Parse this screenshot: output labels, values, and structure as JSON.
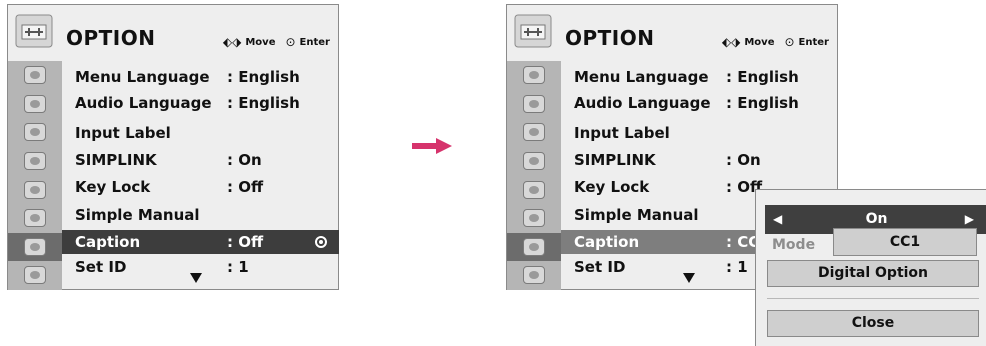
{
  "left_panel": {
    "title": "OPTION",
    "hint_move": "Move",
    "hint_enter": "Enter",
    "rows": [
      {
        "label": "Menu Language",
        "value": ": English"
      },
      {
        "label": "Audio Language",
        "value": ": English"
      },
      {
        "label": "Input Label",
        "value": ""
      },
      {
        "label": "SIMPLINK",
        "value": ": On"
      },
      {
        "label": "Key Lock",
        "value": ": Off"
      },
      {
        "label": "Simple Manual",
        "value": ""
      },
      {
        "label": "Caption",
        "value": ": Off"
      },
      {
        "label": "Set ID",
        "value": ": 1"
      }
    ]
  },
  "right_panel": {
    "title": "OPTION",
    "hint_move": "Move",
    "hint_enter": "Enter",
    "rows": [
      {
        "label": "Menu Language",
        "value": ": English"
      },
      {
        "label": "Audio Language",
        "value": ": English"
      },
      {
        "label": "Input Label",
        "value": ""
      },
      {
        "label": "SIMPLINK",
        "value": ": On"
      },
      {
        "label": "Key Lock",
        "value": ": Off"
      },
      {
        "label": "Simple Manual",
        "value": ""
      },
      {
        "label": "Caption",
        "value": ": CC"
      },
      {
        "label": "Set ID",
        "value": ": 1"
      }
    ]
  },
  "popup": {
    "caption_value": "On",
    "mode_label": "Mode",
    "mode_value": "CC1",
    "digital_option_label": "Digital Option",
    "close_label": "Close"
  },
  "icons": {
    "option": "option-icon",
    "move": "move-arrows-icon",
    "enter": "enter-icon",
    "transition": "right-arrow-icon"
  },
  "colors": {
    "highlight": "#3d3d3d",
    "highlight_dim": "#7e7e7e",
    "transition_arrow": "#d6336c",
    "panel_bg": "#eeeeee"
  }
}
